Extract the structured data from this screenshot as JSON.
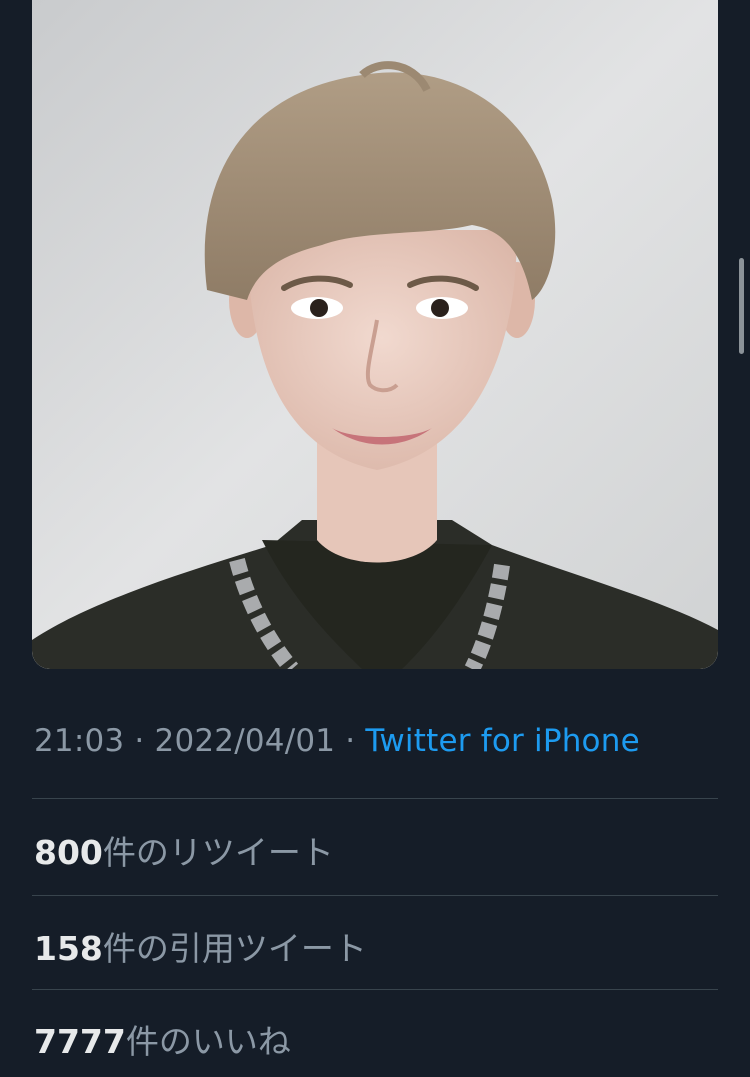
{
  "tweet": {
    "photo_alt": "",
    "time": "21:03",
    "separator": " · ",
    "date": "2022/04/01",
    "source": "Twitter for iPhone"
  },
  "stats": [
    {
      "count": "800",
      "label": "件のリツイート"
    },
    {
      "count": "158",
      "label": "件の引用ツイート"
    },
    {
      "count": "7777",
      "label": "件のいいね"
    }
  ],
  "colors": {
    "background": "#151d28",
    "muted_text": "#8b98a5",
    "link": "#1d9bf0",
    "divider": "#38444d"
  }
}
